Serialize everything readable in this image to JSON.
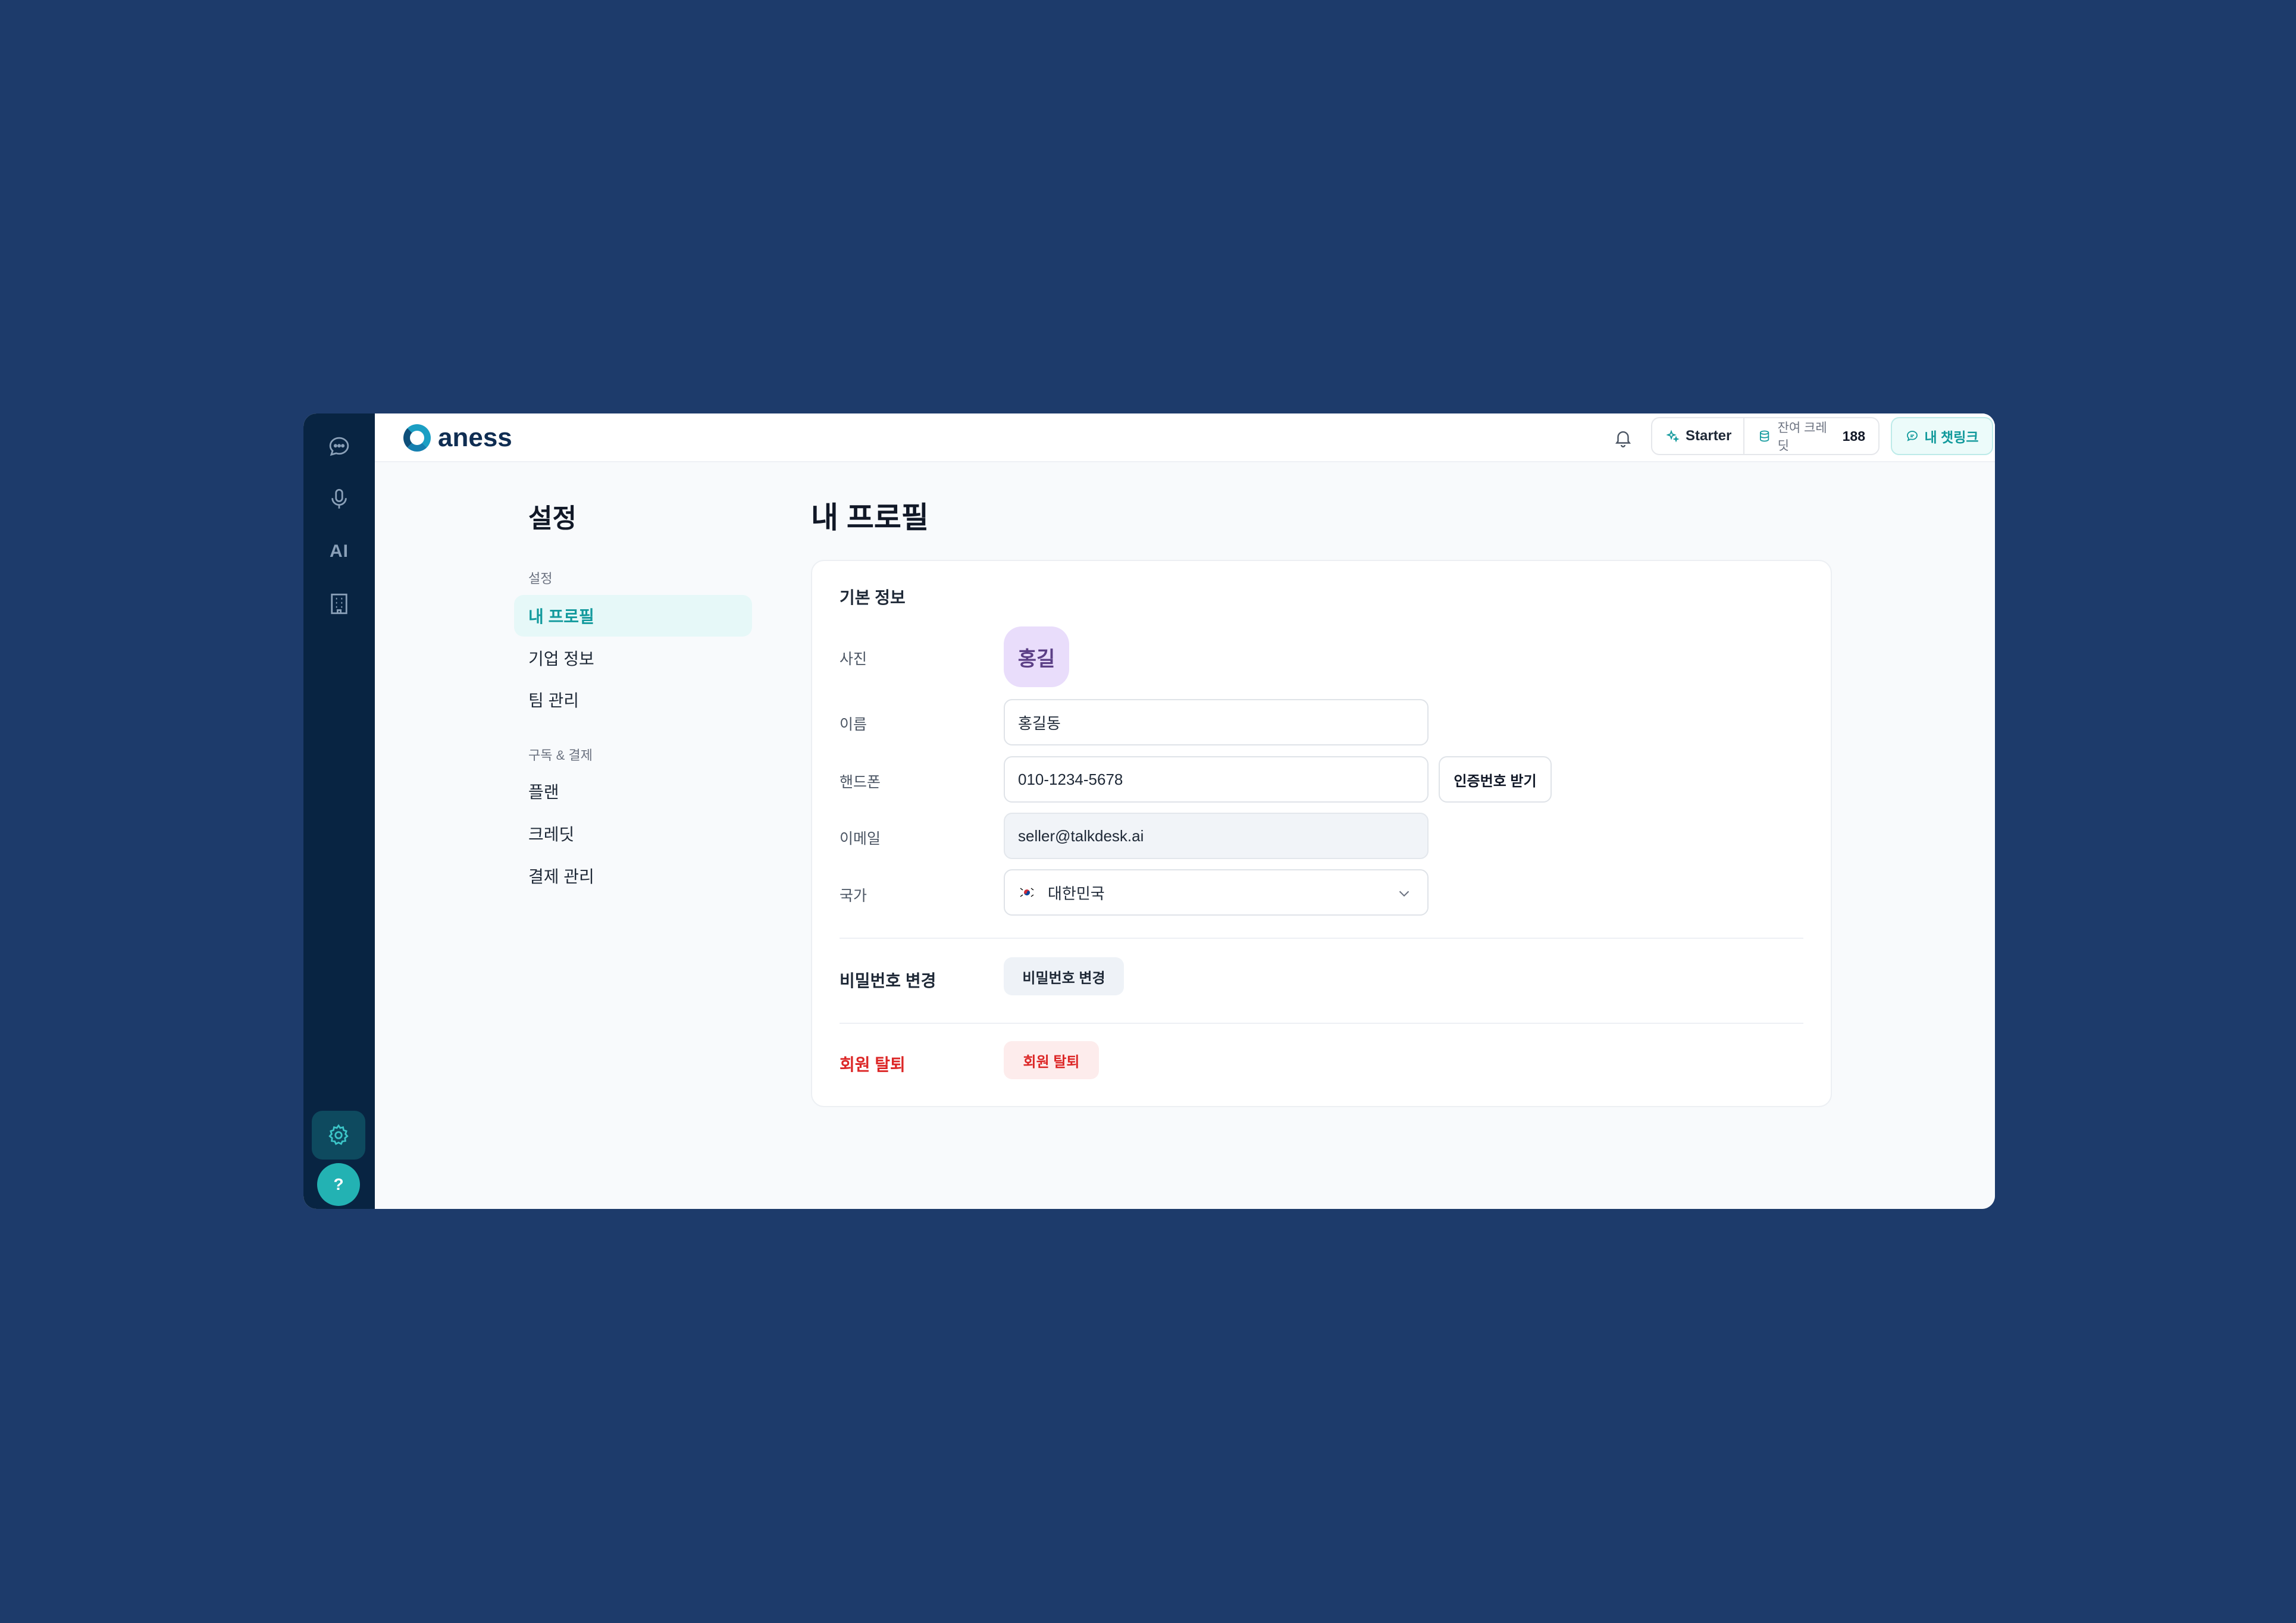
{
  "app": {
    "logo_text": "aness"
  },
  "rail": {
    "ai_label": "AI",
    "help_label": "?"
  },
  "topbar": {
    "plan_name": "Starter",
    "credit_label": "잔여 크레딧",
    "credit_value": "188",
    "chatlink_label": "내 챗링크"
  },
  "settings_nav": {
    "title": "설정",
    "groups": [
      {
        "label": "설정",
        "items": [
          {
            "label": "내 프로필",
            "active": true
          },
          {
            "label": "기업 정보",
            "active": false
          },
          {
            "label": "팀 관리",
            "active": false
          }
        ]
      },
      {
        "label": "구독 & 결제",
        "items": [
          {
            "label": "플랜",
            "active": false
          },
          {
            "label": "크레딧",
            "active": false
          },
          {
            "label": "결제 관리",
            "active": false
          }
        ]
      }
    ]
  },
  "profile": {
    "page_title": "내 프로필",
    "section_title": "기본 정보",
    "photo_label": "사진",
    "avatar_text": "홍길",
    "name_label": "이름",
    "name_value": "홍길동",
    "phone_label": "핸드폰",
    "phone_value": "010-1234-5678",
    "verify_button": "인증번호 받기",
    "email_label": "이메일",
    "email_value": "seller@talkdesk.ai",
    "country_label": "국가",
    "country_value": "대한민국",
    "password_title": "비밀번호 변경",
    "password_button": "비밀번호 변경",
    "withdraw_title": "회원 탈퇴",
    "withdraw_button": "회원 탈퇴"
  },
  "colors": {
    "background": "#1d3b6b",
    "rail": "#082442",
    "accent": "#139a9d",
    "danger": "#dc2626",
    "avatar_bg": "#e9ddfb"
  },
  "icons": [
    "chat-icon",
    "mic-icon",
    "building-icon",
    "gear-icon",
    "bell-icon",
    "sparkle-icon",
    "database-icon",
    "chat-bubble-icon",
    "chevron-down-icon",
    "korea-flag-icon"
  ]
}
